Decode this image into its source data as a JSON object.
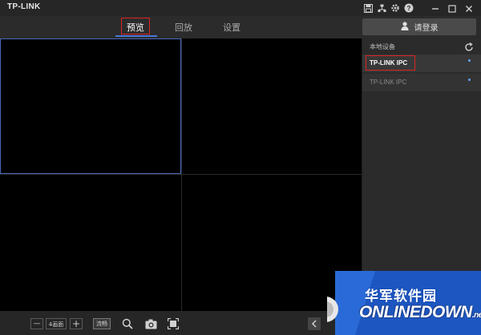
{
  "app": {
    "title": "TP-LINK"
  },
  "titlebar_icons": [
    "save-icon",
    "network-icon",
    "settings-icon",
    "help-icon",
    "minimize-icon",
    "restore-icon",
    "close-icon"
  ],
  "tabs": [
    {
      "label": "预览",
      "active": true
    },
    {
      "label": "回放",
      "active": false
    },
    {
      "label": "设置",
      "active": false
    }
  ],
  "login": {
    "label": "请登录",
    "icon": "user-icon"
  },
  "panel": {
    "title": "本地设备",
    "refresh_icon": "refresh-icon",
    "devices": [
      {
        "name": "TP-LINK IPC",
        "selected": true
      },
      {
        "name": "TP-LINK IPC",
        "selected": false
      }
    ]
  },
  "video": {
    "layout_count": 4,
    "selected_cell": 1
  },
  "toolbar": {
    "minus": "—",
    "layout_label": "4画面",
    "plus": "+",
    "stream_label": "流畅",
    "icons": [
      "zoom-icon",
      "snapshot-icon",
      "fullscreen-icon"
    ],
    "prev_icon": "chevron-left-icon"
  },
  "watermark": {
    "cn": "华军软件园",
    "en": "ONLINEDOWN",
    "suffix": ".net"
  },
  "colors": {
    "accent": "#4a78d6",
    "highlight": "#dd2222",
    "background": "#1e1e1e"
  }
}
